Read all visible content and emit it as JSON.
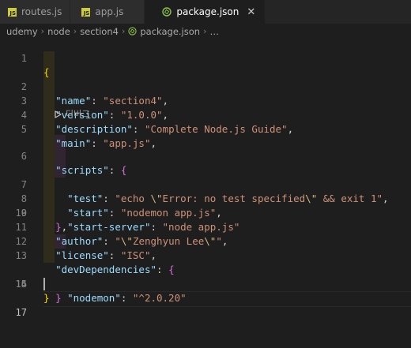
{
  "tabs": [
    {
      "label": "routes.js",
      "icon": "js-icon",
      "active": false
    },
    {
      "label": "app.js",
      "icon": "js-icon",
      "active": false
    },
    {
      "label": "package.json",
      "icon": "npm-icon",
      "active": true
    }
  ],
  "breadcrumb": [
    "udemy",
    "node",
    "section4",
    "package.json",
    "…"
  ],
  "codelens": "디버그",
  "line_numbers": [
    "1",
    "2",
    "3",
    "4",
    "5",
    "6",
    "7",
    "8",
    "9",
    "10",
    "11",
    "12",
    "13",
    "14",
    "15",
    "16",
    "17"
  ],
  "code": {
    "name_key": "\"name\"",
    "name_val": "\"section4\"",
    "version_key": "\"version\"",
    "version_val": "\"1.0.0\"",
    "description_key": "\"description\"",
    "description_val": "\"Complete Node.js Guide\"",
    "main_key": "\"main\"",
    "main_val": "\"app.js\"",
    "scripts_key": "\"scripts\"",
    "test_key": "\"test\"",
    "test_val_1": "\"echo ",
    "test_val_esc1": "\\\"",
    "test_val_2": "Error: no test specified",
    "test_val_esc2": "\\\"",
    "test_val_3": " && exit 1\"",
    "start_key": "\"start\"",
    "start_val": "\"nodemon app.js\"",
    "start_server_key": "\"start-server\"",
    "start_server_val": "\"node app.js\"",
    "author_key": "\"author\"",
    "author_val_1": "\"",
    "author_esc1": "\\\"",
    "author_val_2": "Zenghyun Lee",
    "author_esc2": "\\\"",
    "author_val_3": "\"",
    "license_key": "\"license\"",
    "license_val": "\"ISC\"",
    "devdeps_key": "\"devDependencies\"",
    "nodemon_key": "\"nodemon\"",
    "nodemon_val": "\"^2.0.20\""
  },
  "colors": {
    "background": "#1e1e1e",
    "key": "#9cdcfe",
    "string": "#ce9178",
    "bracket_level1": "#ffd700",
    "bracket_level2": "#da70d6"
  }
}
